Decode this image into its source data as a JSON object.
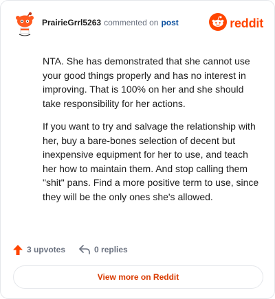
{
  "comment": {
    "username": "PrairieGrrl5263",
    "action": "commented on",
    "post_link": "post",
    "avatar_icon": "reddit-snoo-avatar-icon",
    "paragraphs": [
      "NTA. She has demonstrated that she cannot use your good things properly and has no interest in improving. That is 100% on her and she should take responsibility for her actions.",
      "If you want to try and salvage the relationship with her, buy a bare-bones selection of decent but inexpensive equipment for her to use, and teach her how to maintain them. And stop calling them \"shit\" pans. Find a more positive term to use, since they will be the only ones she's allowed."
    ]
  },
  "brand": {
    "name": "reddit",
    "icon": "reddit-logo-icon",
    "color": "#ff4500"
  },
  "footer": {
    "upvotes": "3 upvotes",
    "replies": "0 replies",
    "upvote_icon": "upvote-arrow-icon",
    "reply_icon": "reply-arrow-icon",
    "upvote_color": "#ff4500"
  },
  "view_more": {
    "label": "View more on Reddit",
    "color": "#d93a00"
  }
}
